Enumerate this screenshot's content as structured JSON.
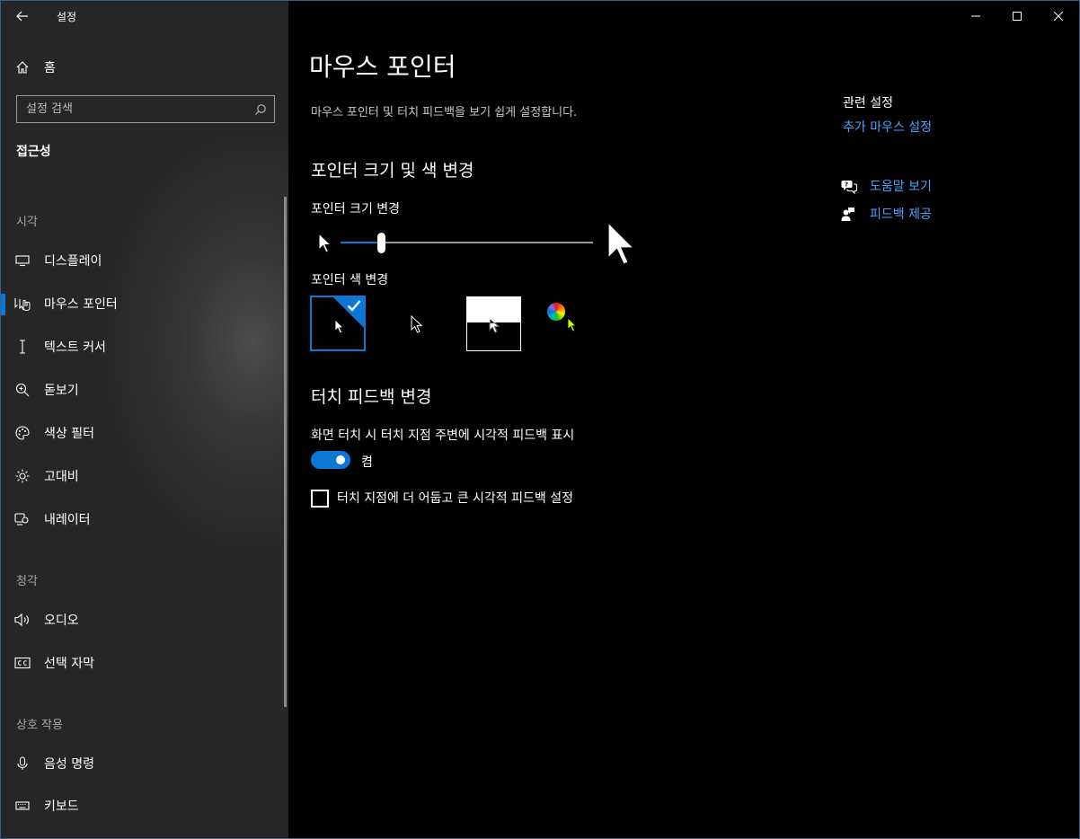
{
  "app": {
    "title": "설정"
  },
  "sidebar": {
    "home_label": "홈",
    "search_placeholder": "설정 검색",
    "section_title": "접근성",
    "groups": [
      {
        "label": "시각",
        "items": [
          {
            "label": "디스플레이",
            "icon": "monitor-icon"
          },
          {
            "label": "마우스 포인터",
            "icon": "mouse-pointer-icon",
            "selected": true
          },
          {
            "label": "텍스트 커서",
            "icon": "text-cursor-icon"
          },
          {
            "label": "돋보기",
            "icon": "magnifier-icon"
          },
          {
            "label": "색상 필터",
            "icon": "palette-icon"
          },
          {
            "label": "고대비",
            "icon": "brightness-icon"
          },
          {
            "label": "내레이터",
            "icon": "narrator-icon"
          }
        ]
      },
      {
        "label": "청각",
        "items": [
          {
            "label": "오디오",
            "icon": "speaker-icon"
          },
          {
            "label": "선택 자막",
            "icon": "closed-caption-icon"
          }
        ]
      },
      {
        "label": "상호 작용",
        "items": [
          {
            "label": "음성 명령",
            "icon": "microphone-icon"
          },
          {
            "label": "키보드",
            "icon": "keyboard-icon"
          }
        ]
      }
    ]
  },
  "main": {
    "title": "마우스 포인터",
    "description": "마우스 포인터 및 터치 피드백을 보기 쉽게 설정합니다.",
    "pointer_section": {
      "heading": "포인터 크기 및 색 변경",
      "size_label": "포인터 크기 변경",
      "size_value_fraction": 0.15,
      "color_label": "포인터 색 변경",
      "color_options": [
        {
          "name": "white-pointer",
          "selected": true
        },
        {
          "name": "black-pointer",
          "selected": false
        },
        {
          "name": "inverted-pointer",
          "selected": false
        },
        {
          "name": "custom-pointer",
          "selected": false,
          "custom_color": "#bfff00"
        }
      ]
    },
    "touch_section": {
      "heading": "터치 피드백 변경",
      "toggle_label": "화면 터치 시 터치 지점 주변에 시각적 피드백 표시",
      "toggle_state": "켬",
      "toggle_on": true,
      "checkbox_label": "터치 지점에 더 어둡고 큰 시각적 피드백 설정",
      "checkbox_checked": false
    }
  },
  "related": {
    "title": "관련 설정",
    "link": "추가 마우스 설정",
    "help_label": "도움말 보기",
    "feedback_label": "피드백 제공"
  },
  "colors": {
    "accent": "#0a78d4",
    "link": "#4fa3ff"
  }
}
